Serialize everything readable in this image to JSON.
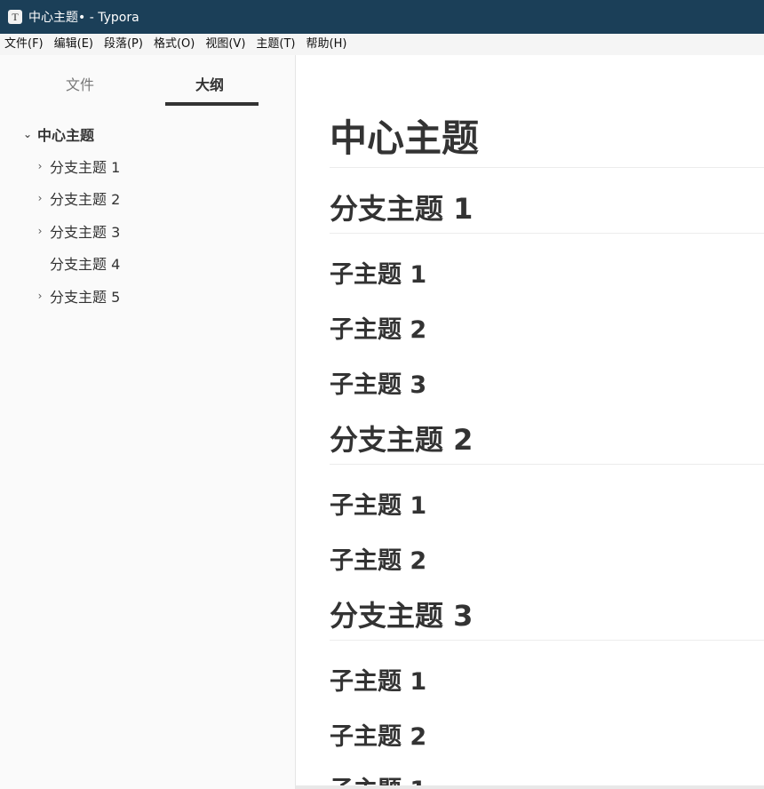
{
  "window": {
    "title": "中心主题• - Typora",
    "app_icon_letter": "T"
  },
  "menubar": {
    "items": [
      "文件(F)",
      "编辑(E)",
      "段落(P)",
      "格式(O)",
      "视图(V)",
      "主题(T)",
      "帮助(H)"
    ]
  },
  "sidebar": {
    "tabs": [
      "文件",
      "大纲"
    ],
    "active_tab": "大纲",
    "outline": [
      {
        "label": "中心主题",
        "chevron": "⌄",
        "expanded": true
      },
      {
        "label": "分支主题 1",
        "chevron": "›"
      },
      {
        "label": "分支主题 2",
        "chevron": "›"
      },
      {
        "label": "分支主题 3",
        "chevron": "›"
      },
      {
        "label": "分支主题 4",
        "chevron": ""
      },
      {
        "label": "分支主题 5",
        "chevron": "›"
      }
    ]
  },
  "editor": {
    "headings": [
      {
        "level": 1,
        "text": "中心主题"
      },
      {
        "level": 2,
        "text": "分支主题 1"
      },
      {
        "level": 3,
        "text": "子主题 1"
      },
      {
        "level": 3,
        "text": "子主题 2"
      },
      {
        "level": 3,
        "text": "子主题 3"
      },
      {
        "level": 2,
        "text": "分支主题 2"
      },
      {
        "level": 3,
        "text": "子主题 1"
      },
      {
        "level": 3,
        "text": "子主题 2"
      },
      {
        "level": 2,
        "text": "分支主题 3"
      },
      {
        "level": 3,
        "text": "子主题 1"
      },
      {
        "level": 3,
        "text": "子主题 2"
      },
      {
        "level": 3,
        "text": "子主题 1"
      }
    ]
  },
  "colors": {
    "titlebar": "#1b3f58",
    "text": "#333333",
    "sidebar_bg": "#fafafa"
  }
}
